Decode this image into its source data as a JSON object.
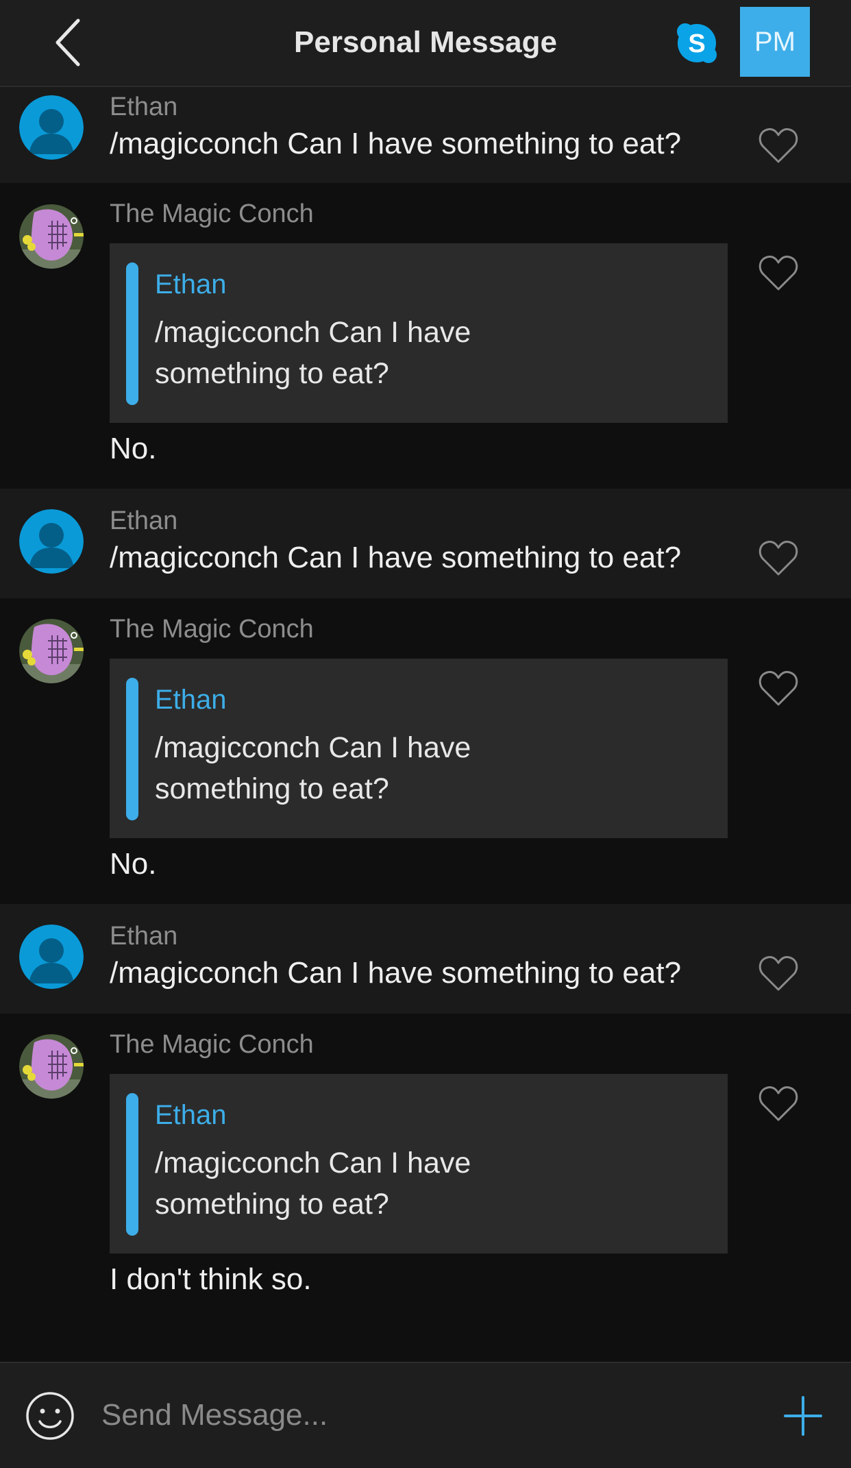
{
  "header": {
    "title": "Personal Message",
    "pm_label": "PM",
    "skype_letter": "S"
  },
  "colors": {
    "accent": "#3daee9",
    "background": "#0f0f0f",
    "user_row": "#1a1a1a",
    "header": "#1e1e1e",
    "quote_bg": "#2b2b2b"
  },
  "messages": [
    {
      "sender": "Ethan",
      "text": "/magicconch Can I have something to eat?"
    },
    {
      "sender": "The Magic Conch",
      "quote_name": "Ethan",
      "quote_text": "/magicconch Can I have something to eat?",
      "text": "No."
    },
    {
      "sender": "Ethan",
      "text": "/magicconch Can I have something to eat?"
    },
    {
      "sender": "The Magic Conch",
      "quote_name": "Ethan",
      "quote_text": "/magicconch Can I have something to eat?",
      "text": "No."
    },
    {
      "sender": "Ethan",
      "text": "/magicconch Can I have something to eat?"
    },
    {
      "sender": "The Magic Conch",
      "quote_name": "Ethan",
      "quote_text": "/magicconch Can I have something to eat?",
      "text": "I don't think so."
    }
  ],
  "composer": {
    "placeholder": "Send Message...",
    "emoji_icon": "smiley-icon",
    "add_icon": "plus-icon"
  }
}
